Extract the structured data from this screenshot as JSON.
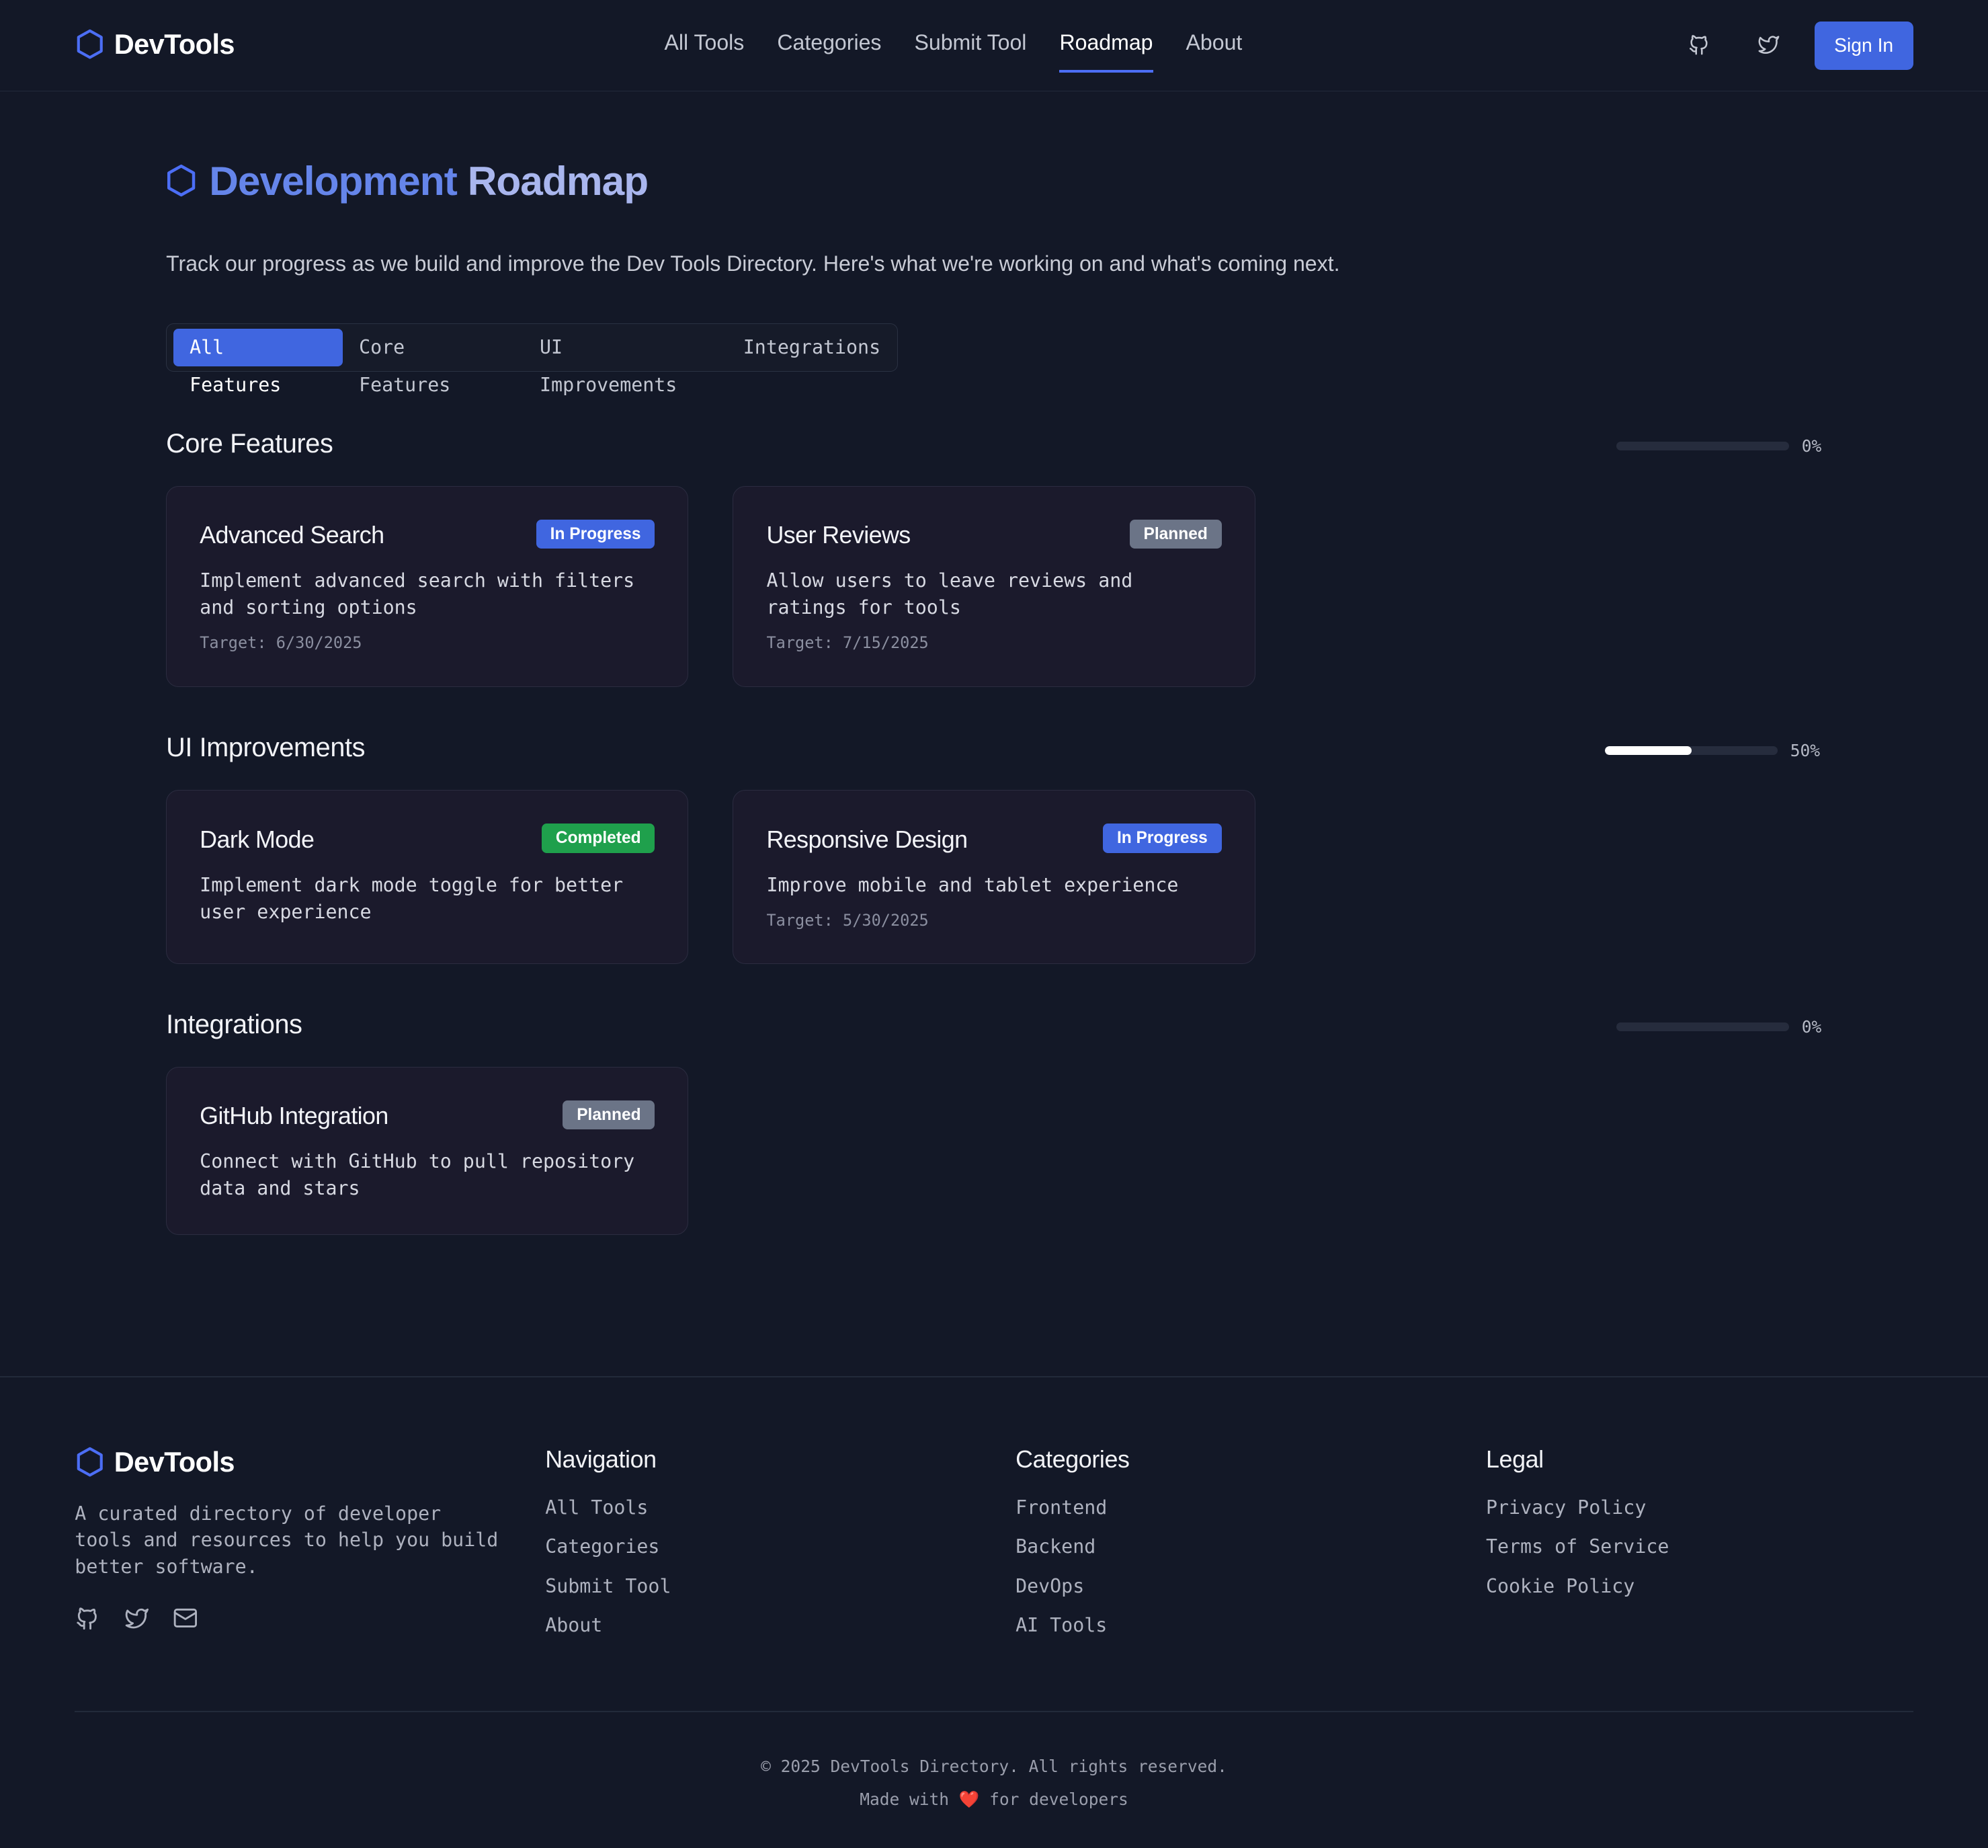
{
  "header": {
    "brand": "DevTools",
    "nav": [
      {
        "label": "All Tools",
        "active": false
      },
      {
        "label": "Categories",
        "active": false
      },
      {
        "label": "Submit Tool",
        "active": false
      },
      {
        "label": "Roadmap",
        "active": true
      },
      {
        "label": "About",
        "active": false
      }
    ],
    "icons": [
      "github-icon",
      "twitter-icon"
    ],
    "signin_label": "Sign In"
  },
  "main": {
    "title_word1": "Development",
    "title_word2": "Roadmap",
    "intro": "Track our progress as we build and improve the Dev Tools Directory. Here's what we're working on and what's coming next.",
    "tabs": [
      {
        "label": "All Features",
        "active": true
      },
      {
        "label": "Core Features",
        "active": false
      },
      {
        "label": "UI Improvements",
        "active": false
      },
      {
        "label": "Integrations",
        "active": false
      }
    ],
    "sections": [
      {
        "title": "Core Features",
        "progress": 0,
        "progress_label": "0%",
        "cards": [
          {
            "title": "Advanced Search",
            "status": "In Progress",
            "desc": "Implement advanced search with filters and sorting options",
            "target": "Target: 6/30/2025"
          },
          {
            "title": "User Reviews",
            "status": "Planned",
            "desc": "Allow users to leave reviews and ratings for tools",
            "target": "Target: 7/15/2025"
          }
        ]
      },
      {
        "title": "UI Improvements",
        "progress": 50,
        "progress_label": "50%",
        "cards": [
          {
            "title": "Dark Mode",
            "status": "Completed",
            "desc": "Implement dark mode toggle for better user experience",
            "target": ""
          },
          {
            "title": "Responsive Design",
            "status": "In Progress",
            "desc": "Improve mobile and tablet experience",
            "target": "Target: 5/30/2025"
          }
        ]
      },
      {
        "title": "Integrations",
        "progress": 0,
        "progress_label": "0%",
        "cards": [
          {
            "title": "GitHub Integration",
            "status": "Planned",
            "desc": "Connect with GitHub to pull repository data and stars",
            "target": ""
          }
        ]
      }
    ]
  },
  "footer": {
    "brand": "DevTools",
    "about": "A curated directory of developer tools and resources to help you build better software.",
    "social_icons": [
      "github-icon",
      "twitter-icon",
      "mail-icon"
    ],
    "columns": [
      {
        "title": "Navigation",
        "links": [
          "All Tools",
          "Categories",
          "Submit Tool",
          "About"
        ]
      },
      {
        "title": "Categories",
        "links": [
          "Frontend",
          "Backend",
          "DevOps",
          "AI Tools"
        ]
      },
      {
        "title": "Legal",
        "links": [
          "Privacy Policy",
          "Terms of Service",
          "Cookie Policy"
        ]
      }
    ],
    "copyright": "© 2025 DevTools Directory. All rights reserved.",
    "made_prefix": "Made with",
    "made_heart": "❤️",
    "made_suffix": "for developers"
  },
  "colors": {
    "background": "#131827",
    "accent": "#4066e0",
    "card": "#1b1a2c",
    "completed": "#1fa04c",
    "planned": "#6b7487"
  }
}
